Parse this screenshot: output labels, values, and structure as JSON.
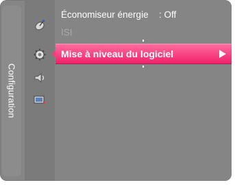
{
  "sidebar": {
    "category_label": "Configuration",
    "icons": [
      "satellite-dish-icon",
      "gear-icon",
      "speaker-icon",
      "input-source-icon"
    ]
  },
  "menu": {
    "items": [
      {
        "label": "Économiseur énergie",
        "value": ": Off",
        "enabled": true
      },
      {
        "label": "ISI",
        "value": "",
        "enabled": false
      },
      {
        "label": "Mise à niveau du logiciel",
        "value": "",
        "enabled": true,
        "selected": true
      }
    ]
  },
  "colors": {
    "panel": "#858585",
    "icon_column": "#7b7b7b",
    "highlight": "#f0226b"
  }
}
